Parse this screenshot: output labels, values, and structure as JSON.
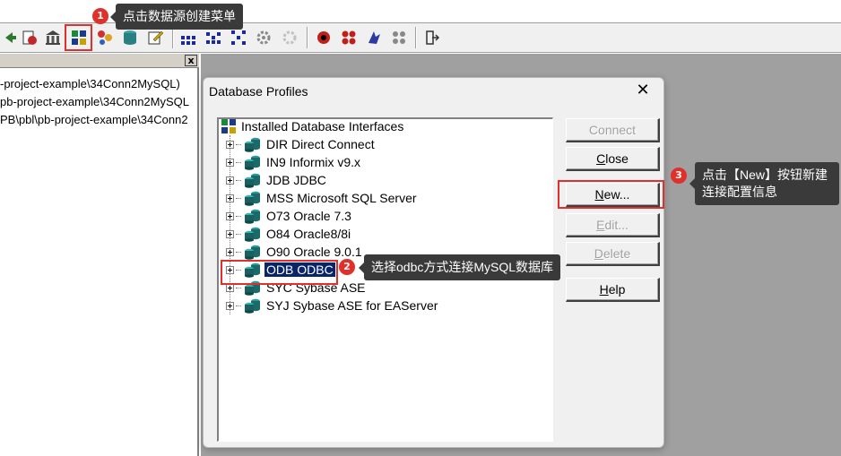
{
  "left_panel": {
    "close_glyph": "x",
    "paths": [
      "-project-example\\34Conn2MySQL)",
      "pb-project-example\\34Conn2MySQL",
      "PB\\pbl\\pb-project-example\\34Conn2"
    ]
  },
  "dialog": {
    "title": "Database Profiles",
    "close_glyph": "✕",
    "tree": {
      "root": "Installed Database Interfaces",
      "items": [
        {
          "label": "DIR Direct Connect"
        },
        {
          "label": "IN9 Informix v9.x"
        },
        {
          "label": "JDB JDBC"
        },
        {
          "label": "MSS Microsoft SQL Server"
        },
        {
          "label": "O73 Oracle 7.3"
        },
        {
          "label": "O84 Oracle8/8i"
        },
        {
          "label": "O90 Oracle 9.0.1"
        },
        {
          "label": "ODB ODBC",
          "selected": true
        },
        {
          "label": "SYC Sybase ASE"
        },
        {
          "label": "SYJ Sybase ASE for EAServer"
        }
      ]
    },
    "buttons": {
      "connect": {
        "pre": "",
        "ul": "",
        "post": "Connect",
        "enabled": false
      },
      "close": {
        "pre": "",
        "ul": "C",
        "post": "lose",
        "enabled": true
      },
      "new": {
        "pre": "",
        "ul": "N",
        "post": "ew...",
        "enabled": true
      },
      "edit": {
        "pre": "",
        "ul": "E",
        "post": "dit...",
        "enabled": false
      },
      "delete": {
        "pre": "",
        "ul": "D",
        "post": "elete",
        "enabled": false
      },
      "help": {
        "pre": "",
        "ul": "H",
        "post": "elp",
        "enabled": true
      }
    }
  },
  "annotations": [
    {
      "number": "1",
      "text": "点击数据源创建菜单"
    },
    {
      "number": "2",
      "text": "选择odbc方式连接MySQL数据库"
    },
    {
      "number": "3",
      "text": "点击【New】按钮新建连接配置信息"
    }
  ],
  "icons": [
    "arrow-icon",
    "library-icon",
    "bank-icon",
    "database-profile-icon",
    "db-painter-icon",
    "db-cylinder-icon",
    "edit-sql-icon",
    "grid-a-icon",
    "grid-b-icon",
    "grid-c-icon",
    "gear-disabled-icon",
    "debug-icon",
    "run-icon",
    "deploy-icon",
    "build-icon",
    "exit-icon"
  ],
  "colors": {
    "accent_red": "#e0302c",
    "tip_bg": "#3a3a3a",
    "selection": "#0a246a",
    "mdi_gray": "#a0a0a0"
  }
}
